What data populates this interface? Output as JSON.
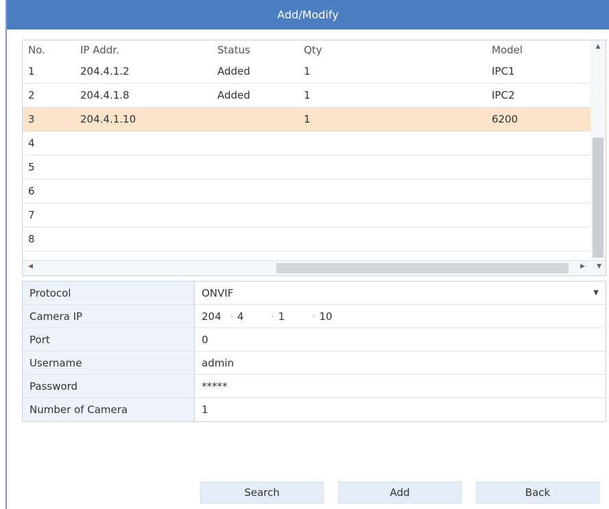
{
  "dialog": {
    "title": "Add/Modify"
  },
  "device_list": {
    "columns": {
      "no": "No.",
      "ip": "IP Addr.",
      "status": "Status",
      "qty": "Qty",
      "model": "Model"
    },
    "rows": [
      {
        "no": "1",
        "ip": "204.4.1.2",
        "status": "Added",
        "qty": "1",
        "model": "IPC1"
      },
      {
        "no": "2",
        "ip": "204.4.1.8",
        "status": "Added",
        "qty": "1",
        "model": "IPC2"
      },
      {
        "no": "3",
        "ip": "204.4.1.10",
        "status": "",
        "qty": "1",
        "model": "6200",
        "selected": true
      },
      {
        "no": "4",
        "ip": "",
        "status": "",
        "qty": "",
        "model": ""
      },
      {
        "no": "5",
        "ip": "",
        "status": "",
        "qty": "",
        "model": ""
      },
      {
        "no": "6",
        "ip": "",
        "status": "",
        "qty": "",
        "model": ""
      },
      {
        "no": "7",
        "ip": "",
        "status": "",
        "qty": "",
        "model": ""
      },
      {
        "no": "8",
        "ip": "",
        "status": "",
        "qty": "",
        "model": ""
      }
    ]
  },
  "form": {
    "protocol_label": "Protocol",
    "protocol_value": "ONVIF",
    "camera_ip_label": "Camera IP",
    "camera_ip": {
      "o1": "204",
      "o2": "4",
      "o3": "1",
      "o4": "10"
    },
    "port_label": "Port",
    "port_value": "0",
    "username_label": "Username",
    "username_value": "admin",
    "password_label": "Password",
    "password_value": "*****",
    "num_cameras_label": "Number of Camera",
    "num_cameras_value": "1"
  },
  "buttons": {
    "search": "Search",
    "add": "Add",
    "back": "Back"
  },
  "icons": {
    "scroll_up": "scroll-up-arrow",
    "scroll_left": "scroll-left-arrow",
    "scroll_right": "scroll-right-arrow",
    "scroll_down": "scroll-down-arrow",
    "dropdown": "chevron-down"
  },
  "colors": {
    "title_bar": "#4a7ec0",
    "selected_row": "#fbe4c9",
    "label_bg": "#eef2fa",
    "button_bg": "#e5edf8"
  }
}
